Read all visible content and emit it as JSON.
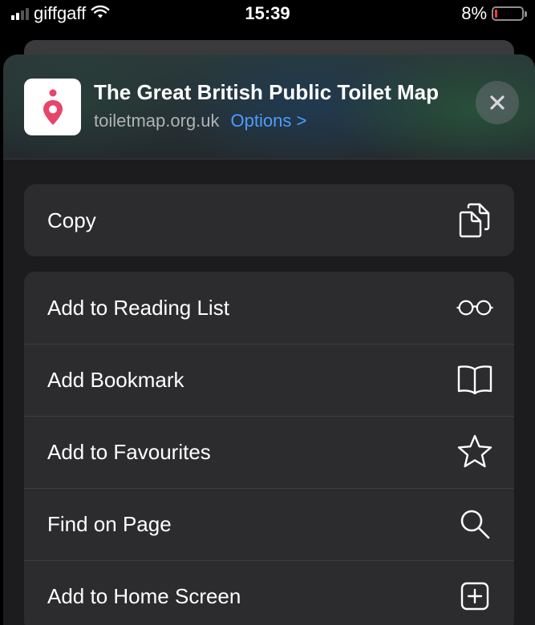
{
  "status_bar": {
    "carrier": "giffgaff",
    "time": "15:39",
    "battery_percent": "8%",
    "battery_level": 0.08,
    "colors": {
      "battery_low": "#ff3b30"
    }
  },
  "share_sheet": {
    "header": {
      "title": "The Great British Public Toilet Map",
      "url": "toiletmap.org.uk",
      "options_label": "Options >",
      "app_icon": "map-pin-icon",
      "close_icon": "close-icon"
    },
    "groups": [
      {
        "items": [
          {
            "label": "Copy",
            "icon": "copy-icon"
          }
        ]
      },
      {
        "items": [
          {
            "label": "Add to Reading List",
            "icon": "glasses-icon"
          },
          {
            "label": "Add Bookmark",
            "icon": "book-icon"
          },
          {
            "label": "Add to Favourites",
            "icon": "star-icon"
          },
          {
            "label": "Find on Page",
            "icon": "search-icon"
          },
          {
            "label": "Add to Home Screen",
            "icon": "plus-square-icon"
          }
        ]
      }
    ]
  },
  "colors": {
    "accent": "#4a9eff",
    "brand_pin": "#e8456b",
    "sheet_bg": "#1c1c1e",
    "row_bg": "#2c2c2e"
  }
}
